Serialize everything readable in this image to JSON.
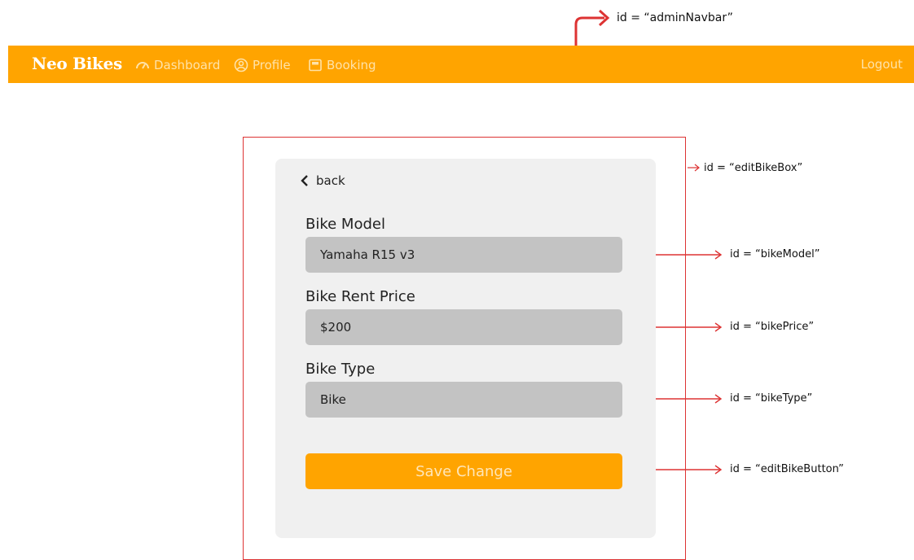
{
  "navbar": {
    "brand": "Neo Bikes",
    "items": [
      {
        "label": "Dashboard",
        "icon": "gauge-icon"
      },
      {
        "label": "Profile",
        "icon": "user-circle-icon"
      },
      {
        "label": "Booking",
        "icon": "calendar-icon"
      }
    ],
    "logout": "Logout",
    "color": "#FFA400"
  },
  "annotations": {
    "navbar_id": "id = “adminNavbar”",
    "box_id": "id = “editBikeBox”",
    "model_id": "id = “bikeModel”",
    "price_id": "id = “bikePrice”",
    "type_id": "id = “bikeType”",
    "button_id": "id = “editBikeButton”",
    "arrow_color": "#d33"
  },
  "form": {
    "back_label": "back",
    "model_label": "Bike Model",
    "model_value": "Yamaha R15 v3",
    "price_label": "Bike Rent Price",
    "price_value": "$200",
    "type_label": "Bike Type",
    "type_value": "Bike",
    "save_label": "Save Change"
  }
}
